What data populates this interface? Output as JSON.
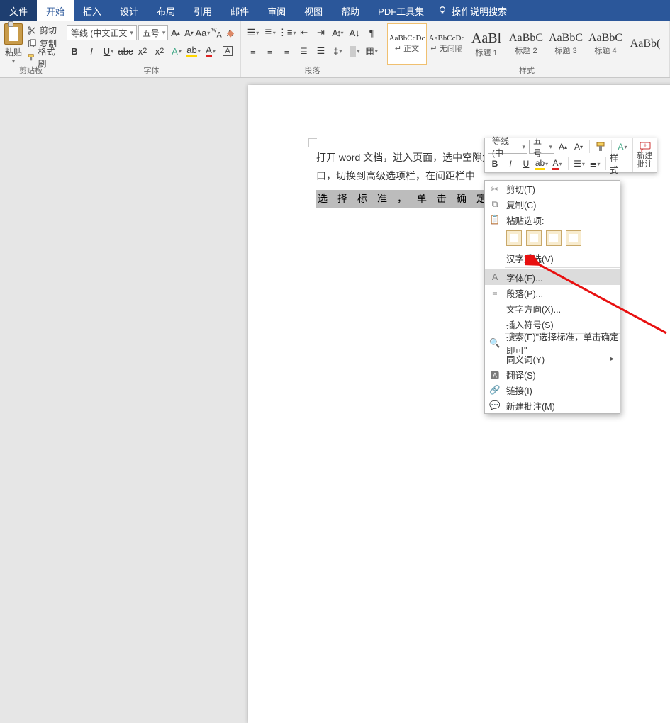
{
  "tabs": {
    "file": "文件",
    "home": "开始",
    "insert": "插入",
    "design": "设计",
    "layout": "布局",
    "references": "引用",
    "mailings": "邮件",
    "review": "审阅",
    "view": "视图",
    "help": "帮助",
    "pdf": "PDF工具集",
    "tell_me": "操作说明搜索"
  },
  "clipboard": {
    "paste": "粘贴",
    "cut": "剪切",
    "copy": "复制",
    "format_painter": "格式刷",
    "group": "剪贴板"
  },
  "font": {
    "name": "等线 (中文正文",
    "size": "五号",
    "group": "字体"
  },
  "paragraph": {
    "group": "段落"
  },
  "styles": {
    "group": "样式",
    "items": [
      {
        "preview": "AaBbCcDc",
        "name": "↵ 正文"
      },
      {
        "preview": "AaBbCcDc",
        "name": "↵ 无间隔"
      },
      {
        "preview": "AaBl",
        "name": "标题 1"
      },
      {
        "preview": "AaBbC",
        "name": "标题 2"
      },
      {
        "preview": "AaBbC",
        "name": "标题 3"
      },
      {
        "preview": "AaBbC",
        "name": "标题 4"
      },
      {
        "preview": "AaBb(",
        "name": ""
      }
    ]
  },
  "doc": {
    "line1": "打开 word 文档，进入页面，选中空隙大的文字内",
    "line2": "口，切换到高级选项栏，在间距栏中",
    "sel": "选择标准，单击确定即"
  },
  "mini": {
    "font": "等线 (中",
    "size": "五号",
    "style_btn": "样式",
    "new_comment": "新建\n批注"
  },
  "ctx": {
    "cut": "剪切(T)",
    "copy": "复制(C)",
    "paste_head": "粘贴选项:",
    "hanzi": "汉字重选(V)",
    "font": "字体(F)...",
    "para": "段落(P)...",
    "textdir": "文字方向(X)...",
    "symbol": "插入符号(S)",
    "search": "搜索(E)\"选择标准，单击确定即可\"",
    "synonym": "同义词(Y)",
    "translate": "翻译(S)",
    "link": "链接(I)",
    "comment": "新建批注(M)"
  }
}
